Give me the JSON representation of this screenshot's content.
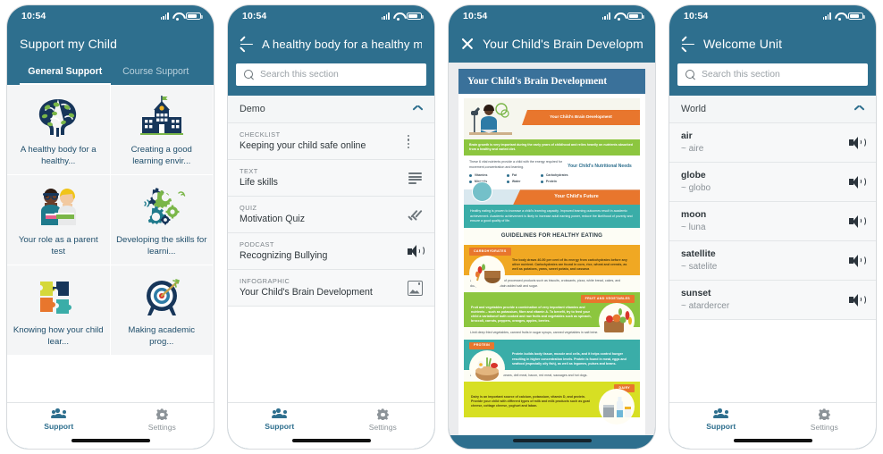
{
  "meta": {
    "accent": "#2e6f8e",
    "card_bg": "#f4f5f6",
    "navy": "#1f4e6b"
  },
  "status": {
    "time": "10:54",
    "signal_icon": "signal-bars-icon",
    "wifi_icon": "wifi-icon",
    "battery_icon": "battery-icon"
  },
  "tabbar": {
    "support_label": "Support",
    "settings_label": "Settings",
    "support_icon": "people-icon",
    "settings_icon": "gear-icon"
  },
  "screens": [
    {
      "id": "support-home",
      "nav": {
        "title": "Support my Child",
        "icon": null
      },
      "tabs": [
        {
          "label": "General Support",
          "active": true
        },
        {
          "label": "Course Support",
          "active": false
        }
      ],
      "cards": [
        {
          "label": "A healthy body for a healthy...",
          "art": "brain-icon"
        },
        {
          "label": "Creating a good learning envir...",
          "art": "school-icon"
        },
        {
          "label": "Your role as a parent test",
          "art": "parents-icon"
        },
        {
          "label": "Developing the skills for learni...",
          "art": "gears-icon"
        },
        {
          "label": "Knowing how your child lear...",
          "art": "puzzle-icon"
        },
        {
          "label": "Making academic prog...",
          "art": "target-icon"
        }
      ]
    },
    {
      "id": "section-contents",
      "nav": {
        "title": "A healthy body for a healthy mi...",
        "icon": "back-arrow-icon"
      },
      "search": {
        "placeholder": "Search this section",
        "icon": "search-icon"
      },
      "section": {
        "title": "Demo",
        "chevron": "chevron-up-icon"
      },
      "rows": [
        {
          "kind": "CHECKLIST",
          "name": "Keeping your child safe online",
          "icon": "checklist-icon"
        },
        {
          "kind": "TEXT",
          "name": "Life skills",
          "icon": "text-lines-icon"
        },
        {
          "kind": "QUIZ",
          "name": "Motivation Quiz",
          "icon": "double-check-icon"
        },
        {
          "kind": "PODCAST",
          "name": "Recognizing Bullying",
          "icon": "speaker-icon"
        },
        {
          "kind": "INFOGRAPHIC",
          "name": "Your Child's Brain Development",
          "icon": "image-icon"
        }
      ]
    },
    {
      "id": "infographic-viewer",
      "nav": {
        "title": "Your Child's Brain Development",
        "icon": "close-icon"
      },
      "banner_title": "Your Child's Brain Development",
      "infographic": {
        "hero_title": "Your Child's Brain Development",
        "intro": "Brain growth is very important during the early years of childhood and relies heavily on nutrients absorbed from a healthy and varied diet.",
        "nutrients_lead": "These 6 vital nutrients provide a child with the energy required for movement,concentration and learning.",
        "nutrients": [
          "Vitamins",
          "Fat",
          "Carbohydrates",
          "Minerals",
          "Water",
          "Protein"
        ],
        "nutrition_needs_title": "Your Child's Nutritional Needs",
        "future_title": "Your Child's Future",
        "future_text": "Healthy eating is proven to increase a child's learning capacity. Improved learning outcomes result in academic achievement. Academic achievement is likely to increase adult earning power, reduce the likelihood of poverty and ensure a good quality of life.",
        "guidelines_title": "GUIDELINES FOR HEALTHY EATING",
        "sections": [
          {
            "tag": "CARBOHYDRATES",
            "body": "The body draws 40-50 per cent of its energy from carbohydrates before any other nutrient. Carbohydrates are found in corn, rice, wheat and cereals, as well as potatoes, yams, sweet potato, and cassava",
            "limit": "Limit your child's intake of processed products such as biscuits, croissants, pizza, white bread, cakes, and doughnuts, which contain added salt and sugar."
          },
          {
            "tag": "FRUIT AND VEGETABLES",
            "body": "Fruit and vegetables provide a combination of very important vitamins and nutrients – such as potassium, fibre and vitamin A. To benefit, try to feed your child a variationof both cooked and raw fruits and vegetables such as spinach, broccoli, carrots, peppers, oranges, apples, berries.",
            "limit": "Limit deep fried vegetables, canned fruits in sugar syrups, canned vegetables in salt brine."
          },
          {
            "tag": "PROTEIN",
            "body": "Protein builds body tissue, muscle and cells, and it helps control hunger resulting in higher concentration levels. Protein is found in meat, eggs and seafood (especially oily fish), as well as legumes, pulses and beans.",
            "limit": "Limit Fried egg, refried beans, deli meat, bacon, red meat, sausages and hot dogs."
          },
          {
            "tag": "DAIRY",
            "body": "Dairy is an important source of calcium, potassium, vitamin D, and protein. Provide your child with different types of milk and milk products such as goat cheese, cottage cheese, yoghurt and laban.",
            "limit": ""
          }
        ]
      }
    },
    {
      "id": "welcome-unit",
      "nav": {
        "title": "Welcome Unit",
        "icon": "back-arrow-icon"
      },
      "search": {
        "placeholder": "Search this section",
        "icon": "search-icon"
      },
      "section": {
        "title": "World",
        "chevron": "chevron-up-icon"
      },
      "words": [
        {
          "term": "air",
          "translation": "~ aire",
          "icon": "speaker-icon"
        },
        {
          "term": "globe",
          "translation": "~ globo",
          "icon": "speaker-icon"
        },
        {
          "term": "moon",
          "translation": "~ luna",
          "icon": "speaker-icon"
        },
        {
          "term": "satellite",
          "translation": "~ satelite",
          "icon": "speaker-icon"
        },
        {
          "term": "sunset",
          "translation": "~ atardercer",
          "icon": "speaker-icon"
        }
      ]
    }
  ]
}
